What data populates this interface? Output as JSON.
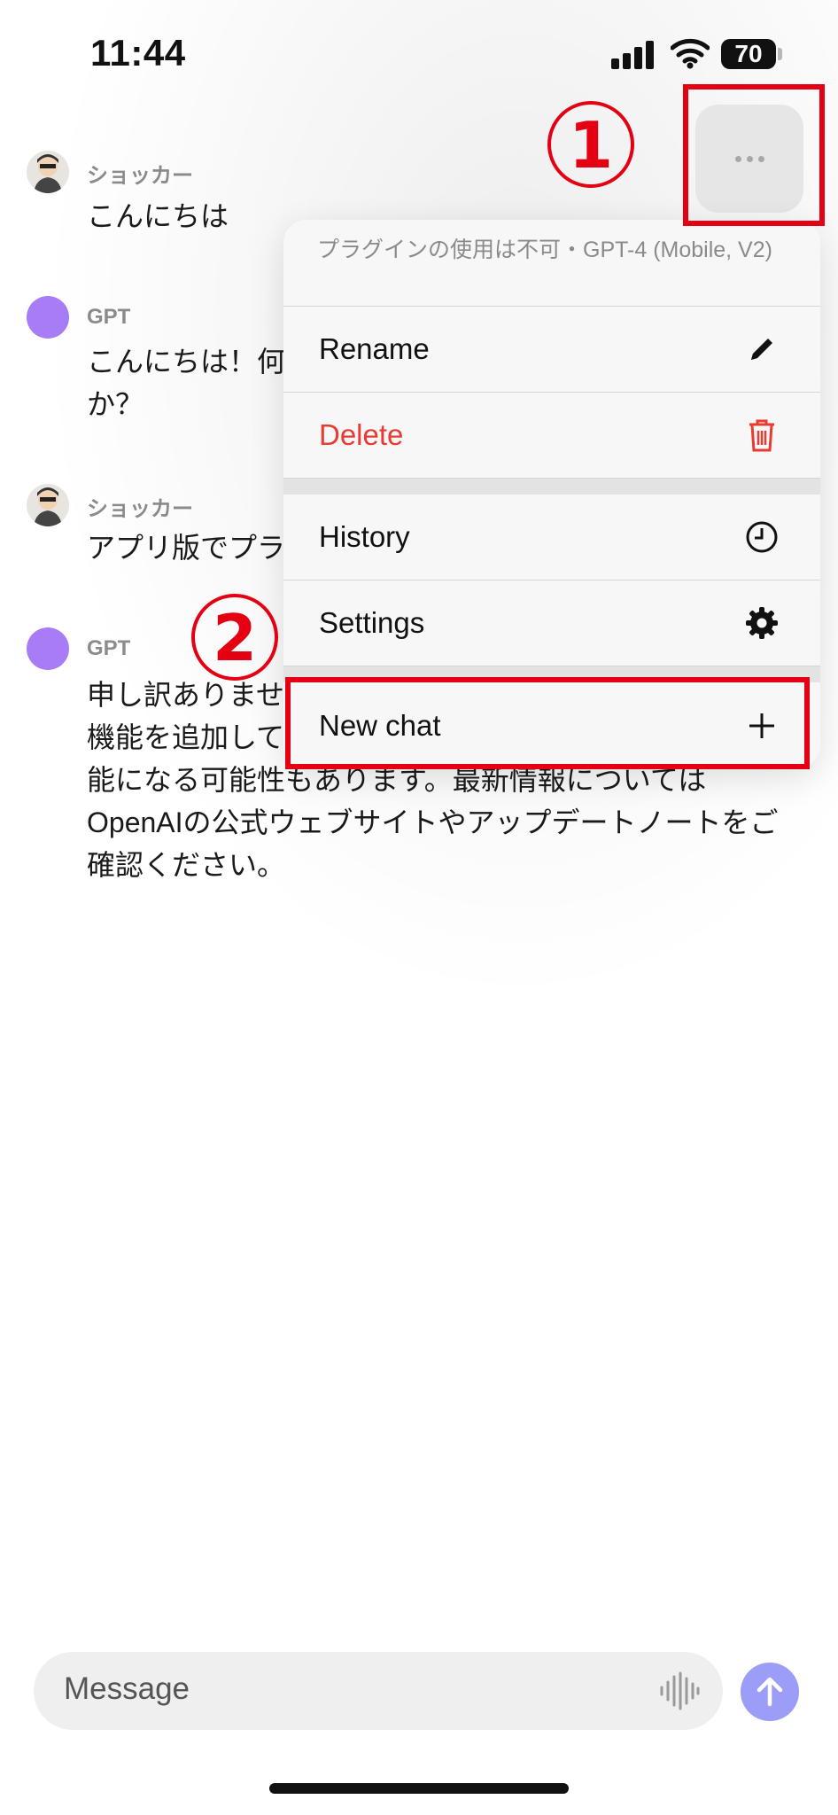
{
  "status": {
    "time": "11:44",
    "battery": "70"
  },
  "messages": [
    {
      "sender": "ショッカー",
      "role": "user",
      "text": "こんにちは"
    },
    {
      "sender": "GPT",
      "role": "assistant",
      "text": "こんにちは！何か？"
    },
    {
      "sender": "ショッカー",
      "role": "user",
      "text": "アプリ版でプラ"
    },
    {
      "sender": "GPT",
      "role": "assistant",
      "text": "申し訳ありませ在、プラグインし、OpenAIは頻繁に新機能を追加しているため、将来的にこの機能が利用可能になる可能性もあります。最新情報についてはOpenAIの公式ウェブサイトやアップデートノートをご確認ください。"
    }
  ],
  "menu": {
    "header": "プラグインの使用は不可・GPT-4 (Mobile, V2)",
    "rename": "Rename",
    "delete": "Delete",
    "history": "History",
    "settings": "Settings",
    "new_chat": "New chat"
  },
  "annotations": {
    "step1": "1",
    "step2": "2"
  },
  "input": {
    "placeholder": "Message"
  },
  "colors": {
    "accent_purple": "#a77cf6",
    "danger": "#ea3b33",
    "annotation_red": "#e40012",
    "send": "#9b9df7"
  }
}
